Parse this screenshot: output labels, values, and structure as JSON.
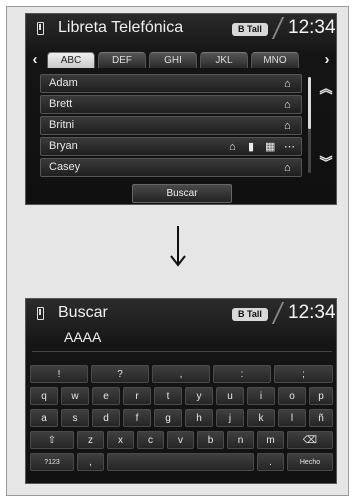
{
  "phonebook": {
    "title": "Libreta Telefónica",
    "bt_label": "B Tall",
    "clock": "12:34",
    "tabs": [
      "ABC",
      "DEF",
      "GHI",
      "JKL",
      "MNO"
    ],
    "active_tab": "ABC",
    "contacts": [
      {
        "name": "Adam"
      },
      {
        "name": "Brett"
      },
      {
        "name": "Britni"
      },
      {
        "name": "Bryan"
      },
      {
        "name": "Casey"
      }
    ],
    "more_glyph": "⋯",
    "search_label": "Buscar"
  },
  "search_screen": {
    "title": "Buscar",
    "bt_label": "B Tall",
    "clock": "12:34",
    "entry_text": "AAAA",
    "keyboard": {
      "row1": [
        "!",
        "?",
        ",",
        ":",
        ";"
      ],
      "row2": [
        "q",
        "w",
        "e",
        "r",
        "t",
        "y",
        "u",
        "i",
        "o",
        "p"
      ],
      "row3": [
        "a",
        "s",
        "d",
        "f",
        "g",
        "h",
        "j",
        "k",
        "l",
        "ñ"
      ],
      "row4": [
        "⇧",
        "z",
        "x",
        "c",
        "v",
        "b",
        "n",
        "m",
        "⌫"
      ],
      "row5_left": "?123",
      "row5_comma": ",",
      "row5_period": ".",
      "row5_done": "Hecho"
    }
  }
}
